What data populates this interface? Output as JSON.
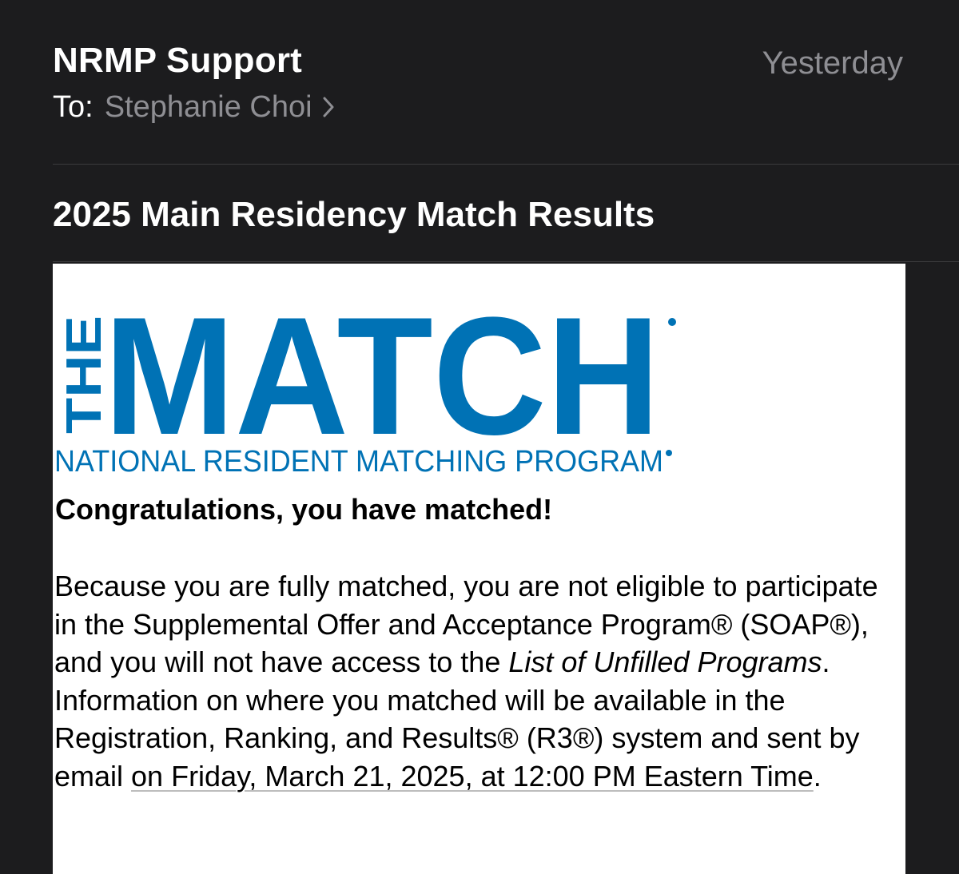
{
  "header": {
    "sender": "NRMP Support",
    "date": "Yesterday",
    "to_label": "To:",
    "recipient": "Stephanie Choi"
  },
  "subject": "2025 Main Residency Match Results",
  "logo": {
    "the": "THE",
    "match": "MATCH",
    "subtitle": "NATIONAL RESIDENT MATCHING PROGRAM",
    "brand_color": "#0072b5"
  },
  "body": {
    "congrats": "Congratulations, you have matched!",
    "p1": "Because you are fully matched, you are not eligible to participate in the Supplemental Offer and Acceptance Program® (SOAP®), and you will not have access to the ",
    "p1_italic": "List of Unfilled Programs",
    "p2": ". Information on where you matched will be available in the Registration, Ranking, and Results® (R3®) system and sent by email ",
    "p2_underlined": "on Friday, March 21, 2025, at 12:00 PM Eastern Time",
    "p3": "."
  },
  "colors": {
    "background": "#1c1c1e",
    "secondary_text": "#8e8e93",
    "divider": "#3a3a3c"
  }
}
